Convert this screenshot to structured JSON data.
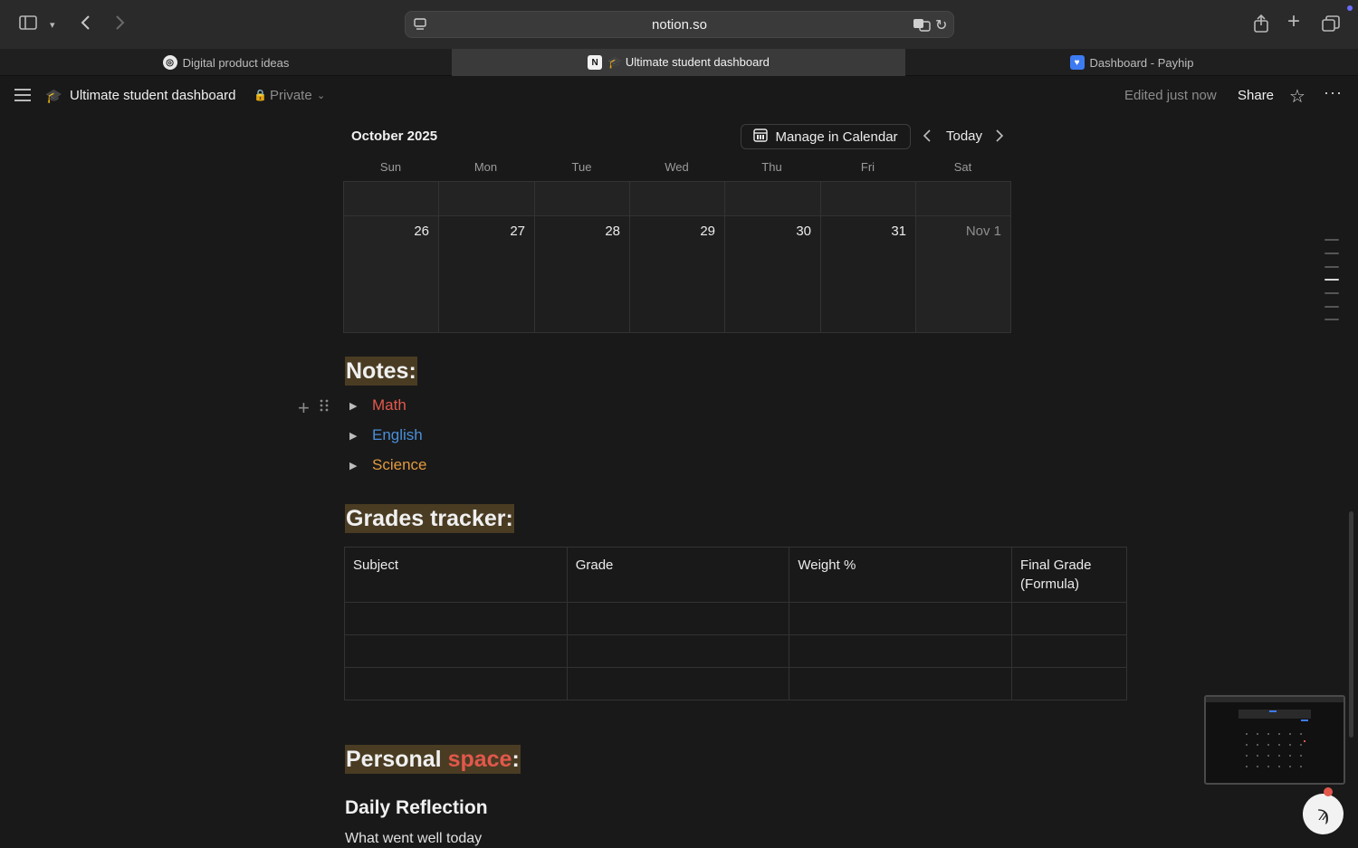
{
  "browser": {
    "url": "notion.so",
    "tabs": [
      {
        "title": "Digital product ideas",
        "favicon": "chatgpt-icon"
      },
      {
        "title": "🎓 Ultimate student dashboard",
        "favicon": "notion-icon"
      },
      {
        "title": "Dashboard - Payhip",
        "favicon": "payhip-icon"
      }
    ]
  },
  "header": {
    "page_title": "Ultimate student dashboard",
    "privacy": "Private",
    "edited": "Edited just now",
    "share": "Share"
  },
  "calendar": {
    "month": "October 2025",
    "manage_label": "Manage in Calendar",
    "today_label": "Today",
    "weekdays": [
      "Sun",
      "Mon",
      "Tue",
      "Wed",
      "Thu",
      "Fri",
      "Sat"
    ],
    "week_dates": [
      "26",
      "27",
      "28",
      "29",
      "30",
      "31",
      "Nov 1"
    ]
  },
  "notes": {
    "heading": "Notes:",
    "items": [
      {
        "label": "Math",
        "color": "#e2584c"
      },
      {
        "label": "English",
        "color": "#4a8fd9"
      },
      {
        "label": "Science",
        "color": "#e29a3e"
      }
    ]
  },
  "grades": {
    "heading": "Grades tracker:",
    "columns": [
      "Subject",
      "Grade",
      "Weight %",
      "Final Grade (Formula)"
    ]
  },
  "personal": {
    "heading_part1": "Personal ",
    "heading_part2": "space",
    "heading_part3": ":",
    "accent": "#e2584c",
    "subheading": "Daily Reflection",
    "body": "What went well today"
  },
  "colors": {
    "background": "#191919",
    "heading_highlight": "#4a3c23"
  }
}
